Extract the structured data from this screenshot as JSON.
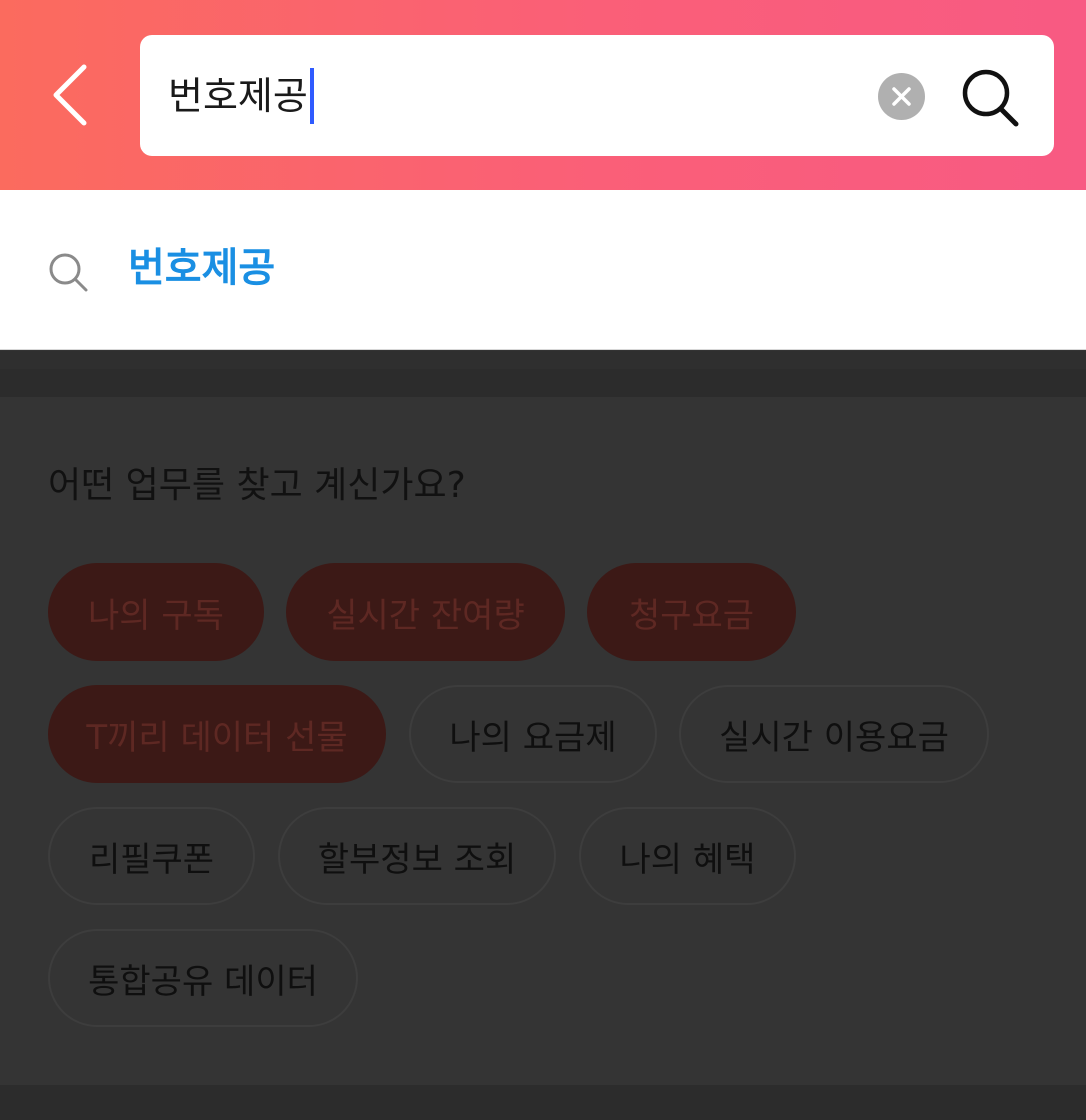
{
  "search": {
    "query": "번호제공"
  },
  "suggestions": [
    {
      "text": "번호제공"
    }
  ],
  "section": {
    "title": "어떤 업무를 찾고 계신가요?"
  },
  "chips": [
    {
      "label": "나의 구독",
      "highlighted": true
    },
    {
      "label": "실시간 잔여량",
      "highlighted": true
    },
    {
      "label": "청구요금",
      "highlighted": true
    },
    {
      "label": "T끼리 데이터 선물",
      "highlighted": true
    },
    {
      "label": "나의 요금제",
      "highlighted": false
    },
    {
      "label": "실시간 이용요금",
      "highlighted": false
    },
    {
      "label": "리필쿠폰",
      "highlighted": false
    },
    {
      "label": "할부정보 조회",
      "highlighted": false
    },
    {
      "label": "나의 혜택",
      "highlighted": false
    },
    {
      "label": "통합공유 데이터",
      "highlighted": false
    }
  ],
  "icons": {
    "back": "chevron-left-icon",
    "clear": "clear-circle-icon",
    "search": "search-icon",
    "suggestion": "search-icon"
  },
  "colors": {
    "header_gradient_start": "#fb6b5e",
    "header_gradient_end": "#f85a83",
    "suggestion_text": "#1a8fe3",
    "caret": "#2f5bff",
    "highlight_chip_bg": "#3c1916",
    "dim_overlay": "#333333"
  }
}
